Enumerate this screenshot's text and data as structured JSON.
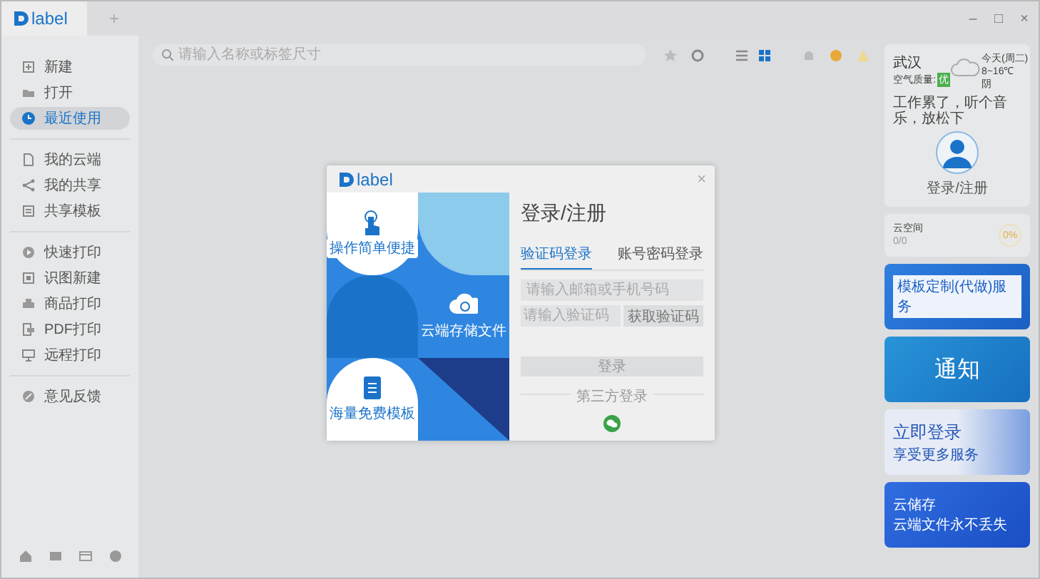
{
  "app": {
    "logo": "label",
    "new_tab": "+"
  },
  "window_controls": [
    "–",
    "□",
    "×"
  ],
  "sidebar": {
    "groups": [
      [
        {
          "label": "新建",
          "selected": false
        },
        {
          "label": "打开",
          "selected": false
        },
        {
          "label": "最近使用",
          "selected": true
        }
      ],
      [
        {
          "label": "我的云端",
          "selected": false
        },
        {
          "label": "我的共享",
          "selected": false
        },
        {
          "label": "共享模板",
          "selected": false
        }
      ],
      [
        {
          "label": "快速打印",
          "selected": false
        },
        {
          "label": "识图新建",
          "selected": false
        },
        {
          "label": "商品打印",
          "selected": false
        },
        {
          "label": "PDF打印",
          "selected": false
        },
        {
          "label": "远程打印",
          "selected": false
        }
      ],
      [
        {
          "label": "意见反馈",
          "selected": false
        }
      ]
    ]
  },
  "search": {
    "placeholder": "请输入名称或标签尺寸"
  },
  "view_toggle": [
    {
      "selected": false
    },
    {
      "selected": true
    }
  ],
  "weather": {
    "city": "武汉",
    "air_label": "空气质量:",
    "air_value": "优",
    "day": "今天(周二)",
    "temp": "8~16℃",
    "condition": "阴",
    "message": "工作累了，听个音乐，放松下"
  },
  "account": {
    "label": "登录/注册"
  },
  "cloud": {
    "title": "云空间",
    "usage": "0/0",
    "percent": "0%"
  },
  "banners": [
    {
      "kind": "service",
      "title": "模板定制(代做)服务"
    },
    {
      "kind": "notice",
      "title": "通知"
    },
    {
      "kind": "login",
      "title": "立即登录",
      "subtitle": "享受更多服务"
    },
    {
      "kind": "storage",
      "title": "云储存",
      "subtitle": "云端文件永不丢失"
    }
  ],
  "dialog": {
    "logo": "label",
    "close": "×",
    "title": "登录/注册",
    "features": [
      "操作简单便捷",
      "云端存储文件",
      "海量免费模板"
    ],
    "tabs": [
      {
        "label": "验证码登录",
        "selected": true
      },
      {
        "label": "账号密码登录",
        "selected": false
      }
    ],
    "phone_placeholder": "请输入邮箱或手机号码",
    "code_placeholder": "请输入验证码",
    "code_button": "获取验证码",
    "submit": "登录",
    "third_party": "第三方登录"
  }
}
